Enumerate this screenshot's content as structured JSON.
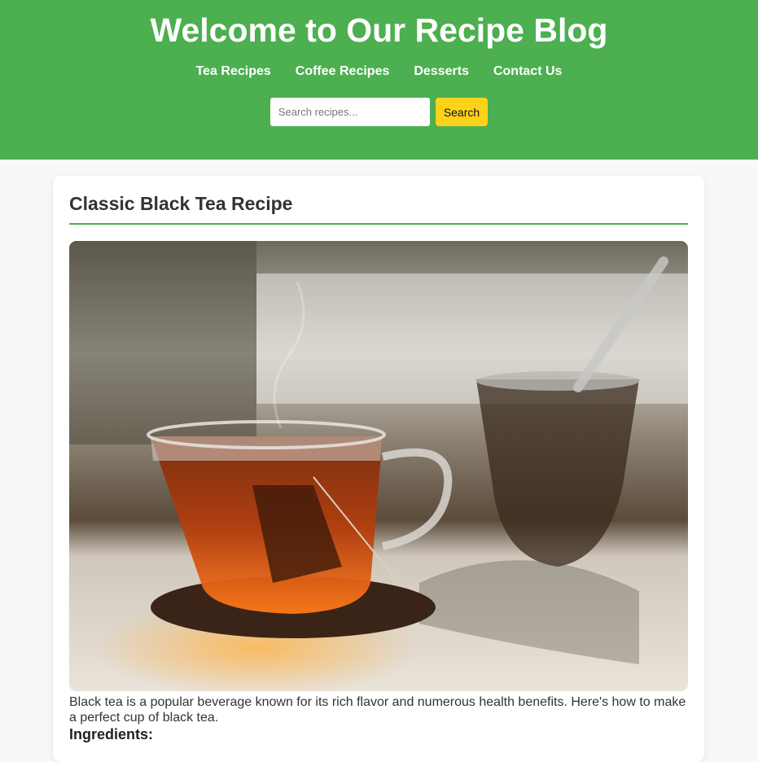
{
  "header": {
    "title": "Welcome to Our Recipe Blog",
    "nav": [
      "Tea Recipes",
      "Coffee Recipes",
      "Desserts",
      "Contact Us"
    ],
    "search": {
      "placeholder": "Search recipes...",
      "button_label": "Search"
    }
  },
  "recipe": {
    "title": "Classic Black Tea Recipe",
    "intro": "Black tea is a popular beverage known for its rich flavor and numerous health benefits. Here's how to make a perfect cup of black tea.",
    "ingredients_heading": "Ingredients:"
  },
  "colors": {
    "header_bg": "#4caf50",
    "search_button": "#ffd21a",
    "accent": "#4caf50"
  }
}
